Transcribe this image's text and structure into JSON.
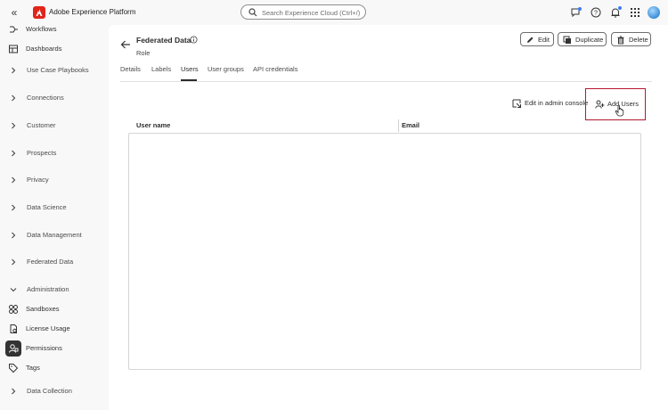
{
  "app": {
    "title": "Adobe Experience Platform"
  },
  "search": {
    "placeholder": "Search Experience Cloud (Ctrl+/)"
  },
  "header_icons": [
    "chat-icon",
    "help-icon",
    "bell-icon",
    "apps-grid-icon",
    "avatar"
  ],
  "sidebar": {
    "items": [
      {
        "label": "Workflows",
        "icon": "workflow-icon",
        "type": "top"
      },
      {
        "label": "Dashboards",
        "icon": "dashboard-icon",
        "type": "top"
      },
      {
        "label": "Use Case Playbooks",
        "icon": "chevron-right-icon",
        "type": "section"
      },
      {
        "label": "Connections",
        "icon": "chevron-right-icon",
        "type": "section"
      },
      {
        "label": "Customer",
        "icon": "chevron-right-icon",
        "type": "section"
      },
      {
        "label": "Prospects",
        "icon": "chevron-right-icon",
        "type": "section"
      },
      {
        "label": "Privacy",
        "icon": "chevron-right-icon",
        "type": "section"
      },
      {
        "label": "Data Science",
        "icon": "chevron-right-icon",
        "type": "section"
      },
      {
        "label": "Data Management",
        "icon": "chevron-right-icon",
        "type": "section"
      },
      {
        "label": "Federated Data",
        "icon": "chevron-right-icon",
        "type": "section"
      },
      {
        "label": "Administration",
        "icon": "chevron-down-icon",
        "type": "section"
      },
      {
        "label": "Sandboxes",
        "icon": "sandboxes-icon",
        "type": "top"
      },
      {
        "label": "License Usage",
        "icon": "license-icon",
        "type": "top"
      },
      {
        "label": "Permissions",
        "icon": "permissions-icon",
        "type": "top",
        "active": true
      },
      {
        "label": "Tags",
        "icon": "tag-icon",
        "type": "top"
      },
      {
        "label": "Data Collection",
        "icon": "chevron-right-icon",
        "type": "section"
      }
    ]
  },
  "page": {
    "title": "Federated Data",
    "subtitle": "Role",
    "buttons": {
      "edit": "Edit",
      "duplicate": "Duplicate",
      "delete": "Delete"
    },
    "tabs": [
      "Details",
      "Labels",
      "Users",
      "User groups",
      "API credentials"
    ],
    "active_tab": "Users"
  },
  "users_panel": {
    "edit_admin_label": "Edit in admin console",
    "add_users_label": "Add Users",
    "columns": [
      "User name",
      "Email"
    ],
    "rows": []
  },
  "colors": {
    "accent": "#e1251b",
    "highlight_border": "#b3182d",
    "active_nav": "#333333"
  }
}
